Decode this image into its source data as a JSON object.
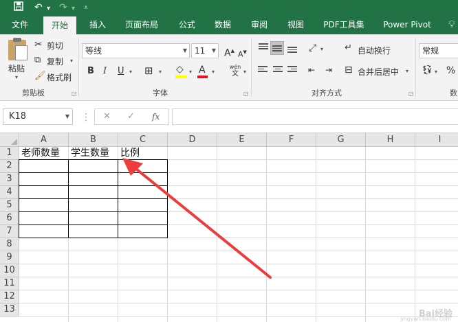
{
  "quick_access": {
    "save_icon": "save-icon",
    "undo_icon": "undo-icon",
    "redo_icon": "redo-icon",
    "customize_icon": "customize-icon"
  },
  "tabs": [
    {
      "label": "文件",
      "active": false
    },
    {
      "label": "开始",
      "active": true
    },
    {
      "label": "插入",
      "active": false
    },
    {
      "label": "页面布局",
      "active": false
    },
    {
      "label": "公式",
      "active": false
    },
    {
      "label": "数据",
      "active": false
    },
    {
      "label": "审阅",
      "active": false
    },
    {
      "label": "视图",
      "active": false
    },
    {
      "label": "PDF工具集",
      "active": false
    },
    {
      "label": "Power Pivot",
      "active": false
    }
  ],
  "tell_me_icon": "lightbulb-icon",
  "clipboard": {
    "paste": "粘贴",
    "cut": "剪切",
    "copy": "复制",
    "format_painter": "格式刷",
    "group_label": "剪贴板"
  },
  "font": {
    "family": "等线",
    "size": "11",
    "grow": "A",
    "shrink": "A",
    "bold": "B",
    "italic": "I",
    "underline": "U",
    "font_color_letter": "A",
    "phonetic_top": "wén",
    "phonetic_bottom": "文",
    "fill_color": "#ffff00",
    "font_color": "#e81123",
    "group_label": "字体"
  },
  "alignment": {
    "wrap_text": "自动换行",
    "merge_center": "合并后居中",
    "group_label": "对齐方式"
  },
  "number": {
    "format": "常规",
    "percent": "%",
    "group_label": "数"
  },
  "formula_bar": {
    "name_box": "K18",
    "cancel": "✕",
    "enter": "✓",
    "fx": "fx",
    "value": ""
  },
  "sheet": {
    "columns": [
      "A",
      "B",
      "C",
      "D",
      "E",
      "F",
      "G",
      "H",
      "I"
    ],
    "rows": [
      "1",
      "2",
      "3",
      "4",
      "5",
      "6",
      "7",
      "8",
      "9",
      "10",
      "11",
      "12",
      "13"
    ],
    "cells": {
      "A1": "老师数量",
      "B1": "学生数量",
      "C1": "比例"
    }
  },
  "annotation_color": "#ee3b3b",
  "watermark": {
    "brand": "Bai经验",
    "url": "jingyan.baidu.com"
  }
}
